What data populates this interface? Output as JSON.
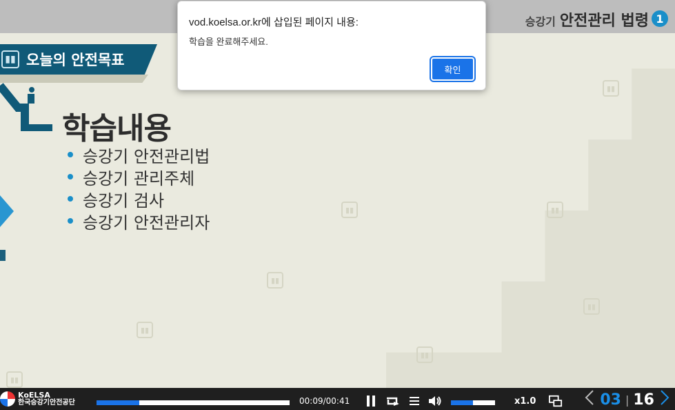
{
  "slide": {
    "header_sub": "승강기",
    "header_main": "안전관리 법령",
    "header_num": "1",
    "goal_label": "오늘의 안전목표",
    "content_title": "학습내용",
    "content_items": [
      "승강기 안전관리법",
      "승강기 관리주체",
      "승강기 검사",
      "승강기 안전관리자"
    ]
  },
  "dialog": {
    "title": "vod.koelsa.or.kr에 삽입된 페이지 내용:",
    "message": "학습을 완료해주세요.",
    "ok_label": "확인"
  },
  "player": {
    "logo_en": "KoELSA",
    "logo_kr": "한국승강기안전공단",
    "progress": 0.22,
    "time": "00:09/00:41",
    "volume": 0.5,
    "speed": "x1.0",
    "page_current": "03",
    "page_total": "16"
  },
  "colors": {
    "accent": "#1a73e8",
    "banner": "#105a78",
    "bullet": "#1a8fc9"
  }
}
